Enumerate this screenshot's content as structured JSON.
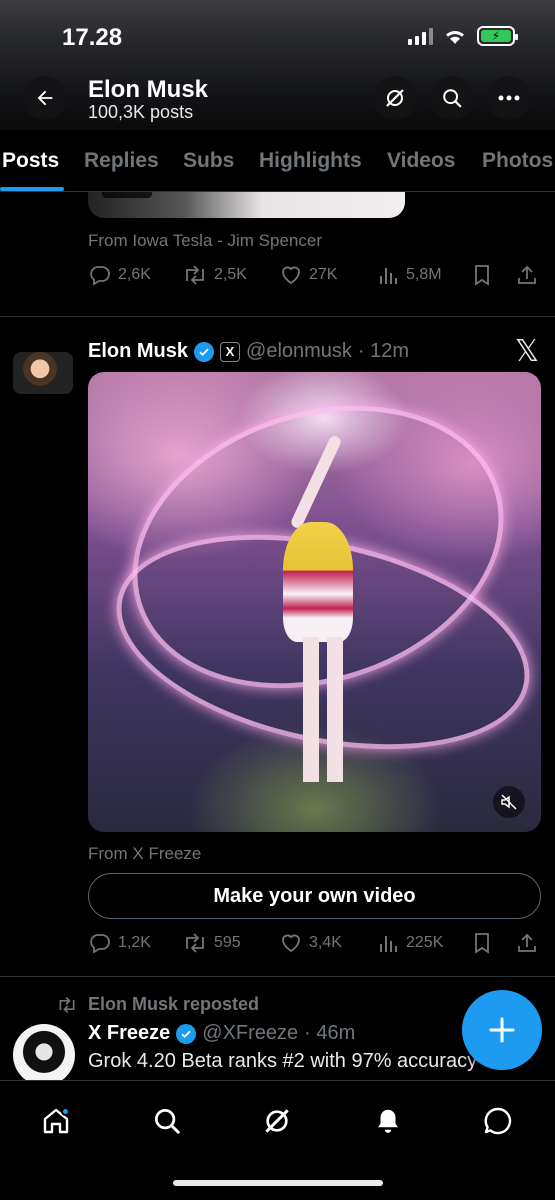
{
  "status_bar": {
    "time": "17.28",
    "battery_color": "#34c759"
  },
  "header": {
    "name": "Elon Musk",
    "post_count": "100,3K posts",
    "back_icon": "arrow-left-icon",
    "grok_icon": "grok-icon",
    "search_icon": "search-icon",
    "more_icon": "more-icon"
  },
  "tabs": [
    {
      "label": "Posts",
      "active": true
    },
    {
      "label": "Replies"
    },
    {
      "label": "Subs"
    },
    {
      "label": "Highlights"
    },
    {
      "label": "Videos"
    },
    {
      "label": "Photos"
    }
  ],
  "posts": [
    {
      "source": "From Iowa Tesla - Jim Spencer",
      "stats": {
        "replies": "2,6K",
        "reposts": "2,5K",
        "likes": "27K",
        "views": "5,8M"
      }
    },
    {
      "name": "Elon Musk",
      "handle": "@elonmusk",
      "time": "· 12m",
      "affiliate_badge": "X",
      "source": "From X Freeze",
      "cta": "Make your own video",
      "stats": {
        "replies": "1,2K",
        "reposts": "595",
        "likes": "3,4K",
        "views": "225K"
      }
    },
    {
      "repost_label": "Elon Musk reposted",
      "name": "X Freeze",
      "handle": "@XFreeze",
      "time": "· 46m",
      "text": "Grok 4.20 Beta ranks #2 with 97% accuracy"
    }
  ],
  "colors": {
    "accent": "#1d9bf0",
    "muted": "#71767b",
    "background": "#000000"
  },
  "bottom_nav": [
    "home-icon",
    "search-icon",
    "grok-icon",
    "notifications-icon",
    "messages-icon"
  ]
}
